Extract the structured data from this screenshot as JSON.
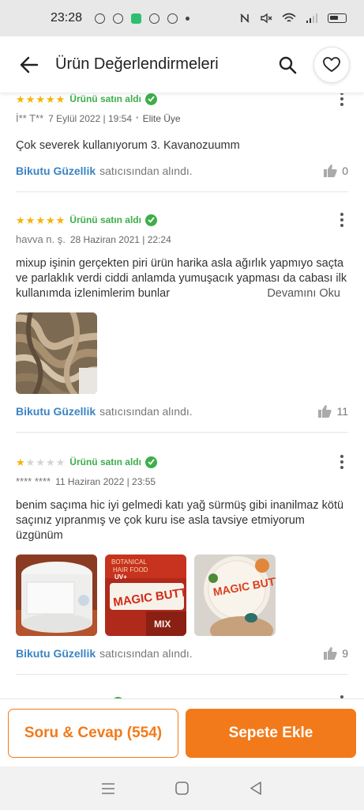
{
  "status_bar": {
    "time": "23:28"
  },
  "header": {
    "title": "Ürün Değerlendirmeleri"
  },
  "reviews": [
    {
      "rating": 5,
      "verified_label": "Ürünü satın aldı",
      "user": "İ** T**",
      "date": "7 Eylül 2022 | 19:54",
      "badge": "Elite Üye",
      "text": "Çok severek kullanıyorum 3. Kavanozuumm",
      "seller": "Bikutu Güzellik",
      "seller_suffix": "satıcısından alındı.",
      "likes": "0"
    },
    {
      "rating": 5,
      "verified_label": "Ürünü satın aldı",
      "user": "havva n. ş.",
      "date": "28 Haziran 2021 | 22:24",
      "text": "mixup işinin gerçekten piri ürün harika asla ağırlık yapmıyo saçta ve parlaklık verdi ciddi anlamda yumuşacık yapması da cabası ilk kullanımda izlenimlerim bunlar",
      "more_label": "Devamını Oku",
      "seller": "Bikutu Güzellik",
      "seller_suffix": "satıcısından alındı.",
      "likes": "11"
    },
    {
      "rating": 1,
      "verified_label": "Ürünü satın aldı",
      "user": "**** ****",
      "date": "11 Haziran 2022 | 23:55",
      "text": "benim saçıma hic iyi gelmedi katı yağ  sürmüş  gibi inanilmaz kötü saçınız yıpranmış ve çok  kuru ise asla tavsiye etmiyorum üzgünüm",
      "image_texts": [
        "BOTANICAL",
        "HAIR FOOD",
        "UV+",
        "MAGIC BUTTER",
        "MIX"
      ],
      "seller": "Bikutu Güzellik",
      "seller_suffix": "satıcısından alındı.",
      "likes": "9"
    }
  ],
  "bottom_bar": {
    "qa_label": "Soru & Cevap (554)",
    "cart_label": "Sepete Ekle"
  },
  "colors": {
    "brand_orange": "#f27a1a",
    "verified_green": "#3dae4a",
    "star_yellow": "#f5b301",
    "seller_blue": "#3b84c4"
  },
  "icons": [
    "back-arrow-icon",
    "search-icon",
    "heart-icon",
    "check-icon",
    "kebab-menu-icon",
    "thumbs-up-icon",
    "menu-lines-icon",
    "home-square-icon",
    "back-triangle-icon"
  ]
}
